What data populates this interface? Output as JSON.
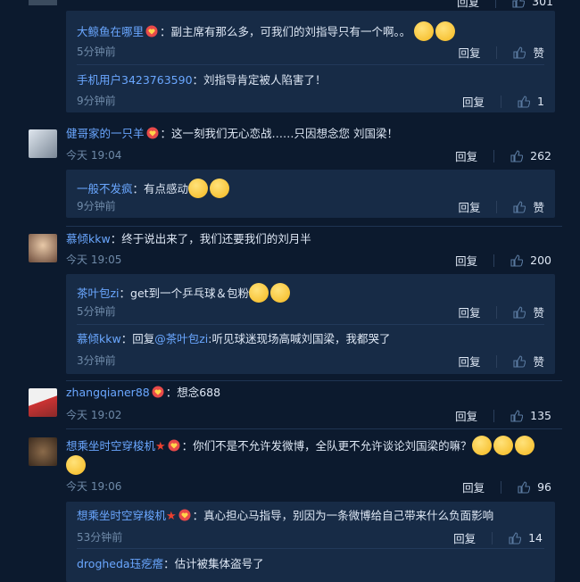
{
  "top": {
    "reply": "回复",
    "likes": "301"
  },
  "c1": {
    "replies": [
      {
        "name": "大鲸鱼在哪里",
        "text": "：副主席有那么多，可我们的刘指导只有一个啊。。",
        "time": "5分钟前",
        "reply": "回复",
        "like": "赞"
      },
      {
        "name": "手机用户3423763590",
        "text": "：刘指导肯定被人陷害了！",
        "time": "9分钟前",
        "reply": "回复",
        "like": "1"
      }
    ]
  },
  "c2": {
    "name": "健哥家的一只羊",
    "text": "：这一刻我们无心恋战……只因想念您 刘国梁！",
    "time": "今天 19:04",
    "reply": "回复",
    "like": "262",
    "replies": [
      {
        "name": "一般不发疯",
        "text": "：有点感动",
        "time": "9分钟前",
        "reply": "回复",
        "like": "赞"
      }
    ]
  },
  "c3": {
    "name": "慕倾kkw",
    "text": "：终于说出来了，我们还要我们的刘月半",
    "time": "今天 19:05",
    "reply": "回复",
    "like": "200",
    "replies": [
      {
        "name": "茶叶包zi",
        "text": "：get到一个乒乓球＆包粉",
        "time": "5分钟前",
        "reply": "回复",
        "like": "赞"
      },
      {
        "name": "慕倾kkw",
        "pre": "：回复",
        "at": "@茶叶包zi",
        "text": ":听见球迷现场高喊刘国梁，我都哭了",
        "time": "3分钟前",
        "reply": "回复",
        "like": "赞"
      }
    ]
  },
  "c4": {
    "name": "zhangqianer88",
    "text": "：想念688",
    "time": "今天 19:02",
    "reply": "回复",
    "like": "135"
  },
  "c5": {
    "name": "想乘坐时空穿梭机",
    "text": "：你们不是不允许发微博，全队更不允许谈论刘国梁的嘛？",
    "time": "今天 19:06",
    "reply": "回复",
    "like": "96",
    "replies": [
      {
        "name": "想乘坐时空穿梭机",
        "text": "：真心担心马指导，别因为一条微博给自己带来什么负面影响",
        "time": "53分钟前",
        "reply": "回复",
        "like": "14"
      },
      {
        "name": "drogheda珏疙瘩",
        "text": "：估计被集体盗号了"
      }
    ]
  },
  "colors": {
    "bg": "#0c1a2e",
    "reply_bg": "#172b46",
    "link": "#6aa7ff",
    "meta": "#6f8aa8"
  }
}
